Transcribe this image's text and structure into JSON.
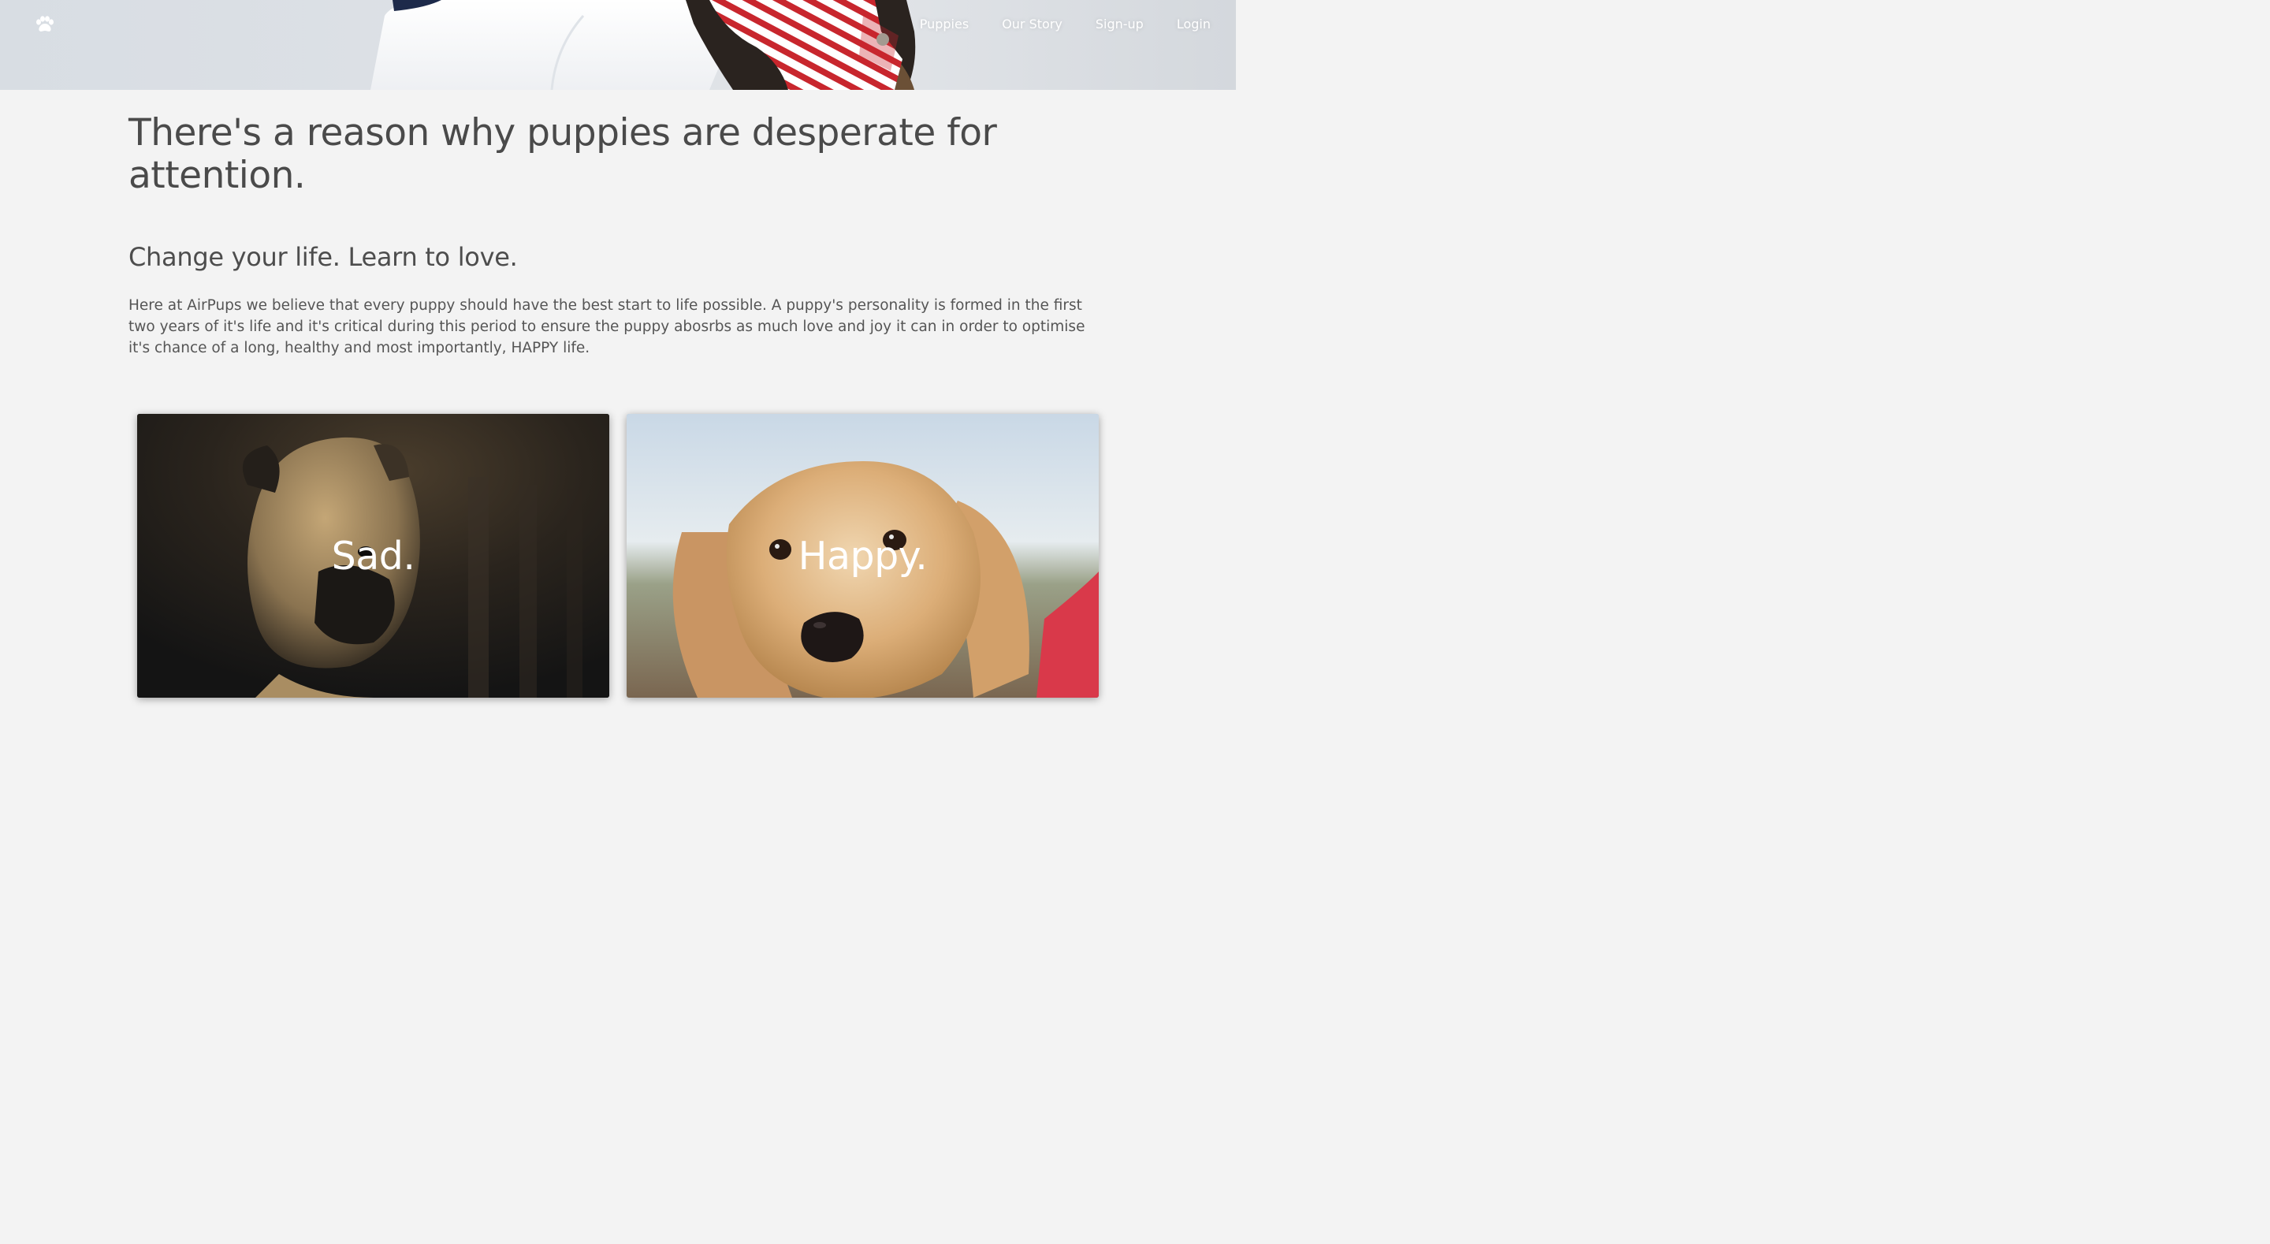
{
  "header": {
    "logo_icon": "paw-icon",
    "nav": [
      {
        "label": "Puppies"
      },
      {
        "label": "Our Story"
      },
      {
        "label": "Sign-up"
      },
      {
        "label": "Login"
      }
    ]
  },
  "main": {
    "headline": "There's a reason why puppies are desperate for attention.",
    "subheadline": "Change your life. Learn to love.",
    "paragraph": "Here at AirPups we believe that every puppy should have the best start to life possible. A puppy's personality is formed in the first two years of it's life and it's critical during this period to ensure the puppy abosrbs as much love and joy it can in order to optimise it's chance of a long, healthy and most importantly, HAPPY life."
  },
  "cards": [
    {
      "label": "Sad."
    },
    {
      "label": "Happy."
    }
  ],
  "colors": {
    "background": "#f3f3f3",
    "text": "#4a4a4a",
    "nav_text": "#ffffff"
  }
}
